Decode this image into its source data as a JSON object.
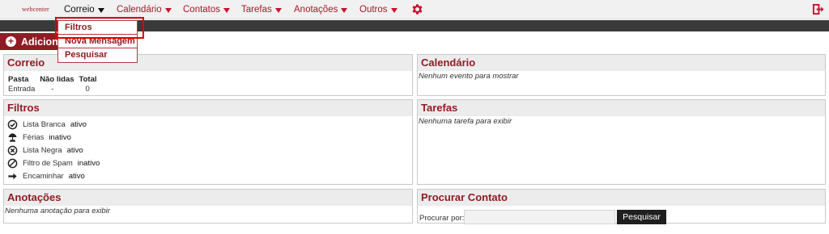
{
  "nav": {
    "logo": "webcenter",
    "items": [
      {
        "label": "Correio",
        "active": true
      },
      {
        "label": "Calendário"
      },
      {
        "label": "Contatos"
      },
      {
        "label": "Tarefas"
      },
      {
        "label": "Anotações"
      },
      {
        "label": "Outros"
      }
    ],
    "gear_icon": "gear-icon",
    "logout_icon": "logout-icon",
    "accent_color": "#c8102e"
  },
  "dropdown": {
    "items": [
      "Filtros",
      "Nova Mensagem",
      "Pesquisar"
    ]
  },
  "add_button": {
    "label": "Adicion"
  },
  "correio": {
    "title": "Correio",
    "headers": [
      "Pasta",
      "Não lidas",
      "Total"
    ],
    "rows": [
      [
        "Entrada",
        "-",
        "0"
      ]
    ]
  },
  "calendario": {
    "title": "Calendário",
    "empty": "Nenhum evento para mostrar"
  },
  "filtros": {
    "title": "Filtros",
    "items": [
      {
        "label": "Lista Branca",
        "status": "ativo",
        "icon": "check-circle-icon"
      },
      {
        "label": "Férias",
        "status": "inativo",
        "icon": "vacation-icon"
      },
      {
        "label": "Lista Negra",
        "status": "ativo",
        "icon": "x-circle-icon"
      },
      {
        "label": "Filtro de Spam",
        "status": "inativo",
        "icon": "no-spam-icon"
      },
      {
        "label": "Encaminhar",
        "status": "ativo",
        "icon": "arrow-right-icon"
      }
    ]
  },
  "tarefas": {
    "title": "Tarefas",
    "empty": "Nenhuma tarefa para exibir"
  },
  "anotacoes": {
    "title": "Anotações",
    "empty": "Nenhuma anotação para exibir"
  },
  "procurar": {
    "title": "Procurar Contato",
    "label": "Procurar por:",
    "input_value": "",
    "button": "Pesquisar"
  }
}
